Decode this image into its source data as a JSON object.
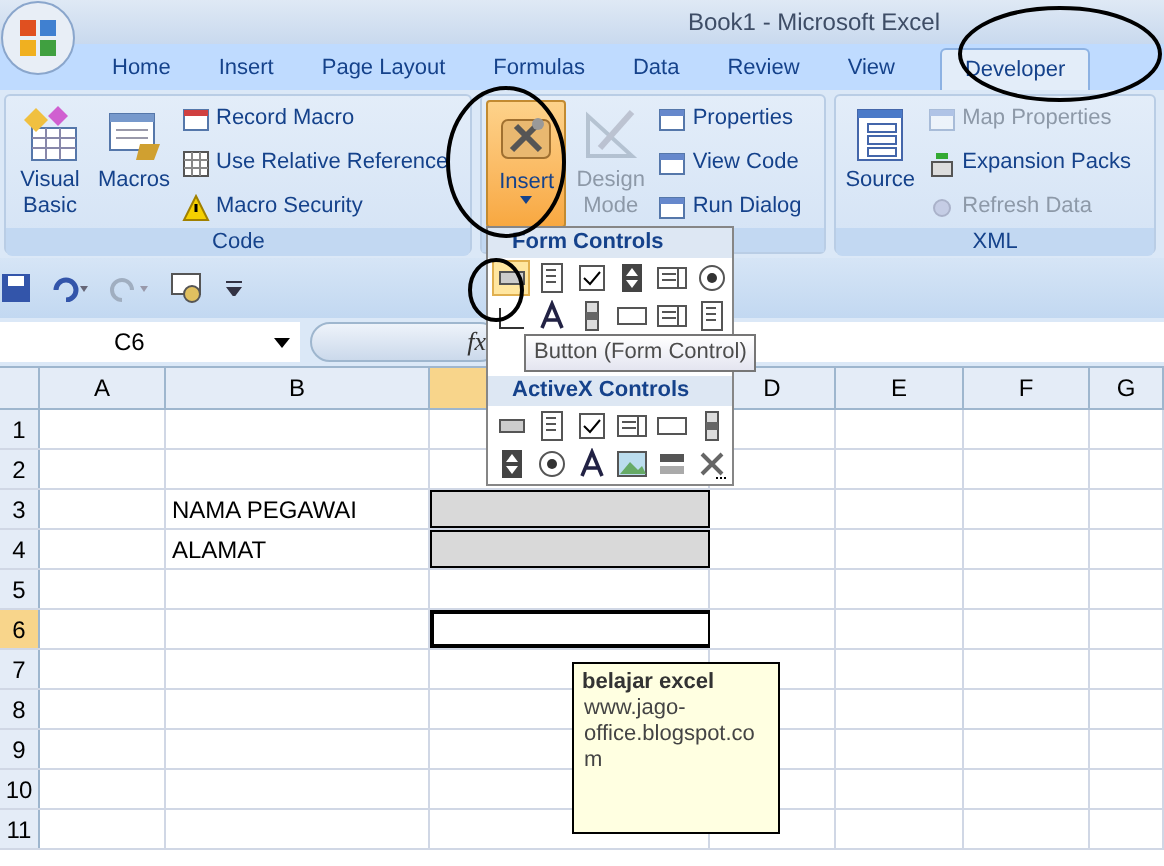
{
  "title_bar": {
    "title": "Book1 - Microsoft Excel"
  },
  "tabs": [
    {
      "label": "Home",
      "selected": false
    },
    {
      "label": "Insert",
      "selected": false
    },
    {
      "label": "Page Layout",
      "selected": false
    },
    {
      "label": "Formulas",
      "selected": false
    },
    {
      "label": "Data",
      "selected": false
    },
    {
      "label": "Review",
      "selected": false
    },
    {
      "label": "View",
      "selected": false
    },
    {
      "label": "Developer",
      "selected": true
    }
  ],
  "ribbon_groups": [
    {
      "label": "Code",
      "items": [
        {
          "kind": "large",
          "label": "Visual Basic",
          "disabled": false,
          "pressed": false,
          "dropdown": false
        },
        {
          "kind": "large",
          "label": "Macros",
          "disabled": false,
          "pressed": false,
          "dropdown": false
        },
        {
          "kind": "small",
          "label": "Record Macro",
          "disabled": false
        },
        {
          "kind": "small",
          "label": "Use Relative Reference",
          "disabled": false
        },
        {
          "kind": "small",
          "label": "Macro Security",
          "disabled": false
        }
      ]
    },
    {
      "items": [
        {
          "kind": "large",
          "label": "Insert",
          "disabled": false,
          "pressed": true,
          "dropdown": true
        },
        {
          "kind": "large",
          "label": "Design Mode",
          "disabled": true,
          "pressed": false,
          "dropdown": false
        },
        {
          "kind": "small",
          "label": "Properties",
          "disabled": false
        },
        {
          "kind": "small",
          "label": "View Code",
          "disabled": false
        },
        {
          "kind": "small",
          "label": "Run Dialog",
          "disabled": false
        }
      ]
    },
    {
      "label": "XML",
      "items": [
        {
          "kind": "large",
          "label": "Source",
          "disabled": false,
          "pressed": false,
          "dropdown": false
        },
        {
          "kind": "small",
          "label": "Map Properties",
          "disabled": true
        },
        {
          "kind": "small",
          "label": "Expansion Packs",
          "disabled": false
        },
        {
          "kind": "small",
          "label": "Refresh Data",
          "disabled": true
        }
      ]
    }
  ],
  "formula_bar": {
    "name_box": "C6",
    "fx_label": "fx"
  },
  "columns": [
    {
      "label": "A",
      "selected": false
    },
    {
      "label": "B",
      "selected": false
    },
    {
      "selected": true
    },
    {
      "label": "D",
      "selected": false
    },
    {
      "label": "E",
      "selected": false
    },
    {
      "label": "F",
      "selected": false
    },
    {
      "label": "G",
      "selected": false
    }
  ],
  "rows": [
    {
      "header": "1",
      "selected": false,
      "column_c_filled": false
    },
    {
      "header": "2",
      "selected": false,
      "column_c_filled": false
    },
    {
      "header": "3",
      "selected": false,
      "column_b_text": "NAMA PEGAWAI",
      "column_c_filled": true
    },
    {
      "header": "4",
      "selected": false,
      "column_b_text": "ALAMAT",
      "column_c_filled": true
    },
    {
      "header": "5",
      "selected": false,
      "column_c_filled": false
    },
    {
      "header": "6",
      "selected": true,
      "column_c_filled": false
    },
    {
      "header": "7",
      "selected": false,
      "column_c_filled": false
    },
    {
      "header": "8",
      "selected": false,
      "column_c_filled": false
    },
    {
      "header": "9",
      "selected": false,
      "column_c_filled": false
    },
    {
      "header": "10",
      "selected": false,
      "column_c_filled": false
    },
    {
      "header": "11",
      "selected": false,
      "column_c_filled": false
    }
  ],
  "controls_menu": {
    "sections": [
      {
        "title": "Form Controls",
        "controls": [
          {
            "kind": "button",
            "selected": true
          },
          {
            "kind": "combo",
            "selected": false
          },
          {
            "kind": "checkbox",
            "selected": false
          },
          {
            "kind": "spin",
            "selected": false
          },
          {
            "kind": "listbox",
            "selected": false
          },
          {
            "kind": "option",
            "selected": false
          },
          {
            "kind": "groupbox",
            "selected": false
          },
          {
            "kind": "label",
            "selected": false
          },
          {
            "kind": "scrollbar",
            "selected": false
          },
          {
            "kind": "textfield",
            "selected": false
          },
          {
            "kind": "listbox",
            "selected": false
          },
          {
            "kind": "combo",
            "selected": false
          }
        ]
      },
      {
        "title": "ActiveX Controls",
        "controls": [
          {
            "kind": "button",
            "selected": false
          },
          {
            "kind": "combo",
            "selected": false
          },
          {
            "kind": "checkbox",
            "selected": false
          },
          {
            "kind": "listbox",
            "selected": false
          },
          {
            "kind": "textfield",
            "selected": false
          },
          {
            "kind": "scrollbar",
            "selected": false
          },
          {
            "kind": "spin",
            "selected": false
          },
          {
            "kind": "option",
            "selected": false
          },
          {
            "kind": "label",
            "selected": false
          },
          {
            "kind": "image",
            "selected": false
          },
          {
            "kind": "toggle",
            "selected": false
          },
          {
            "kind": "more",
            "selected": false
          }
        ]
      }
    ],
    "tooltip": "Button (Form Control)"
  },
  "comment": {
    "author": "belajar excel",
    "text": "www.jago-office.blogspot.com"
  }
}
